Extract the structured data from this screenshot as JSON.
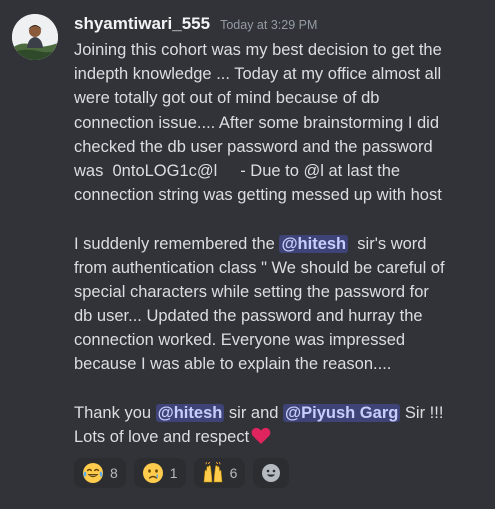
{
  "message": {
    "author": "shyamtiwari_555",
    "timestamp": "Today at 3:29 PM",
    "lines": [
      "Joining this cohort was my best decision to get the",
      "indepth knowledge ... Today at my office almost all",
      "were totally got out of mind because of db",
      "connection issue.... After some brainstorming I did",
      "checked the db user password and the password",
      "was  0ntoLOG1c@l     - Due to @l at last the",
      "connection string was getting messed up with host",
      "",
      "I suddenly remembered the ",
      "from authentication class \" We should be careful of",
      "special characters while setting the password for",
      "db user... Updated the password and hurray the",
      "connection worked. Everyone was impressed",
      "because I was able to explain the reason....",
      "",
      "Thank you "
    ],
    "mention_line_9_mention": "@hitesh",
    "mention_line_9_after": "  sir's word",
    "line_16_mention_1": "@hitesh",
    "line_16_between": " sir and ",
    "line_16_mention_2": "@Piyush Garg",
    "line_16_after": " Sir !!!",
    "line_17_text": "Lots of love and respect"
  },
  "reactions": [
    {
      "icon": "joy-emoji-icon",
      "count": "8"
    },
    {
      "icon": "crying-face-emoji-icon",
      "count": "1"
    },
    {
      "icon": "raising-hands-emoji-icon",
      "count": "6"
    }
  ],
  "colors": {
    "background": "#313338",
    "mention_bg": "#5865f2",
    "heart": "#e0245e"
  }
}
